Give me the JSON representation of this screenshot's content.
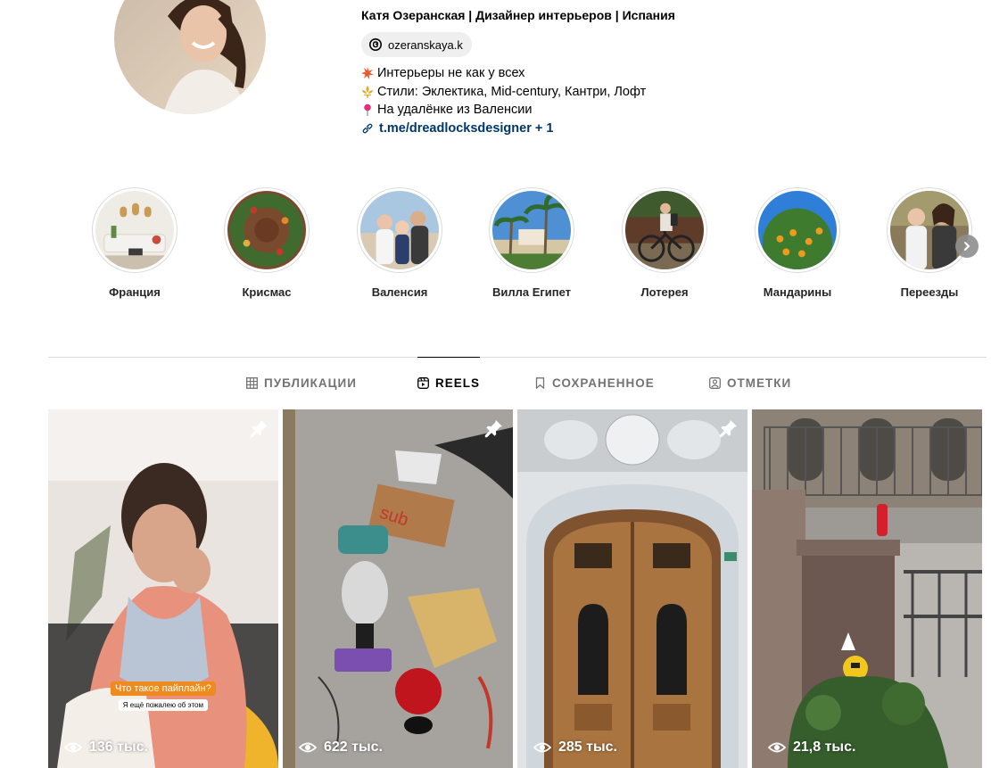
{
  "profile": {
    "name_line": "Катя Озеранская | Дизайнер интерьеров | Испания",
    "threads_handle": "ozeranskaya.k",
    "bio_lines": [
      {
        "emoji": "sparkle-burst-icon",
        "text": "Интерьеры не как у всех"
      },
      {
        "emoji": "fleur-de-lis-icon",
        "text": "Стили: Эклектика, Mid-century, Кантри, Лофт"
      },
      {
        "emoji": "round-pushpin-icon",
        "text": "На удалёнке из Валенсии"
      }
    ],
    "link": "t.me/dreadlocksdesigner + 1"
  },
  "highlights": [
    {
      "label": "Франция",
      "theme": "room"
    },
    {
      "label": "Крисмас",
      "theme": "wreath"
    },
    {
      "label": "Валенсия",
      "theme": "family"
    },
    {
      "label": "Вилла Египет",
      "theme": "palms"
    },
    {
      "label": "Лотерея",
      "theme": "bike"
    },
    {
      "label": "Мандарины",
      "theme": "tree"
    },
    {
      "label": "Переезды",
      "theme": "portrait"
    }
  ],
  "tabs": [
    {
      "label": "ПУБЛИКАЦИИ",
      "icon": "grid-icon",
      "active": false
    },
    {
      "label": "REELS",
      "icon": "reels-icon",
      "active": true
    },
    {
      "label": "СОХРАНЕННОЕ",
      "icon": "bookmark-icon",
      "active": false
    },
    {
      "label": "ОТМЕТКИ",
      "icon": "tagged-icon",
      "active": false
    }
  ],
  "reels": [
    {
      "views": "136 тыс.",
      "pinned": true,
      "caption_top": "Что такое пайплайн?",
      "caption_bottom": "Я ещё пожалею об этом"
    },
    {
      "views": "622 тыс.",
      "pinned": true
    },
    {
      "views": "285 тыс.",
      "pinned": true
    },
    {
      "views": "21,8 тыс.",
      "pinned": false
    }
  ],
  "colors": {
    "link": "#00376b",
    "tab_inactive": "#737373",
    "caption_orange": "#f08a1c",
    "divider": "#dbdbdb"
  }
}
